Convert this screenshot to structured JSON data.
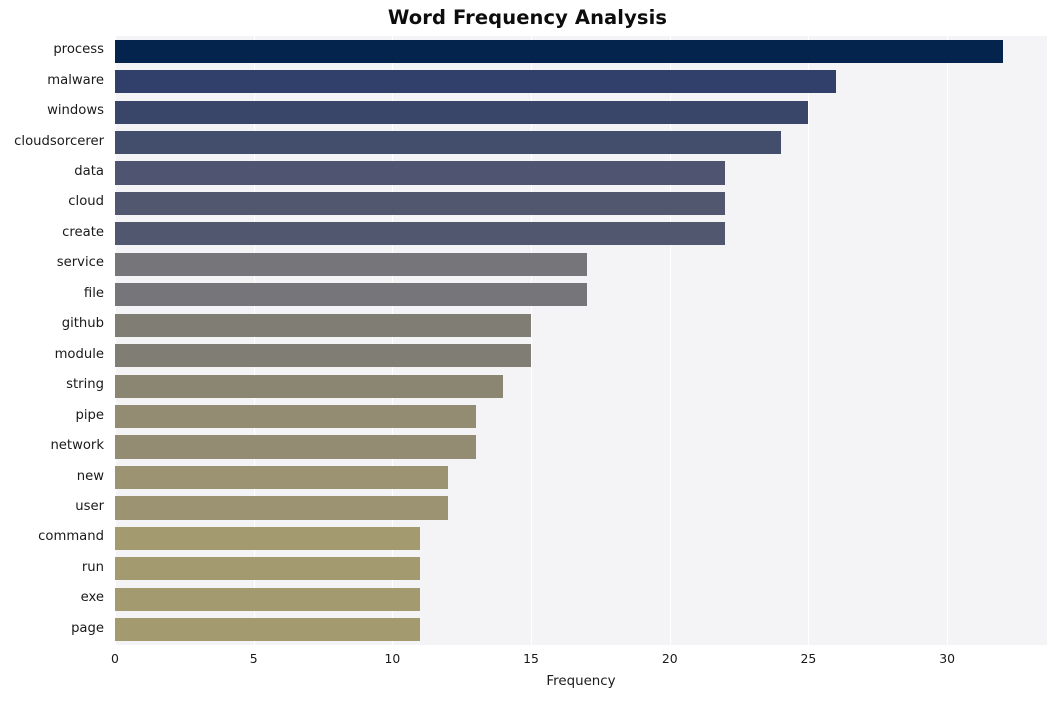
{
  "chart_data": {
    "type": "bar",
    "orientation": "horizontal",
    "title": "Word Frequency Analysis",
    "xlabel": "Frequency",
    "ylabel": "",
    "xlim": [
      0,
      33.6
    ],
    "xticks": [
      0,
      5,
      10,
      15,
      20,
      25,
      30
    ],
    "xtick_labels": [
      "0",
      "5",
      "10",
      "15",
      "20",
      "25",
      "30"
    ],
    "grid": "vertical-only",
    "legend": "none",
    "categories": [
      "process",
      "malware",
      "windows",
      "cloudsorcerer",
      "data",
      "cloud",
      "create",
      "service",
      "file",
      "github",
      "module",
      "string",
      "pipe",
      "network",
      "new",
      "user",
      "command",
      "run",
      "exe",
      "page"
    ],
    "values": [
      32,
      26,
      25,
      24,
      22,
      22,
      22,
      17,
      17,
      15,
      15,
      14,
      13,
      13,
      12,
      12,
      11,
      11,
      11,
      11
    ],
    "bar_colors": [
      "#04234d",
      "#31406b",
      "#3a4669",
      "#434d6c",
      "#4f5570",
      "#51576f",
      "#51576f",
      "#76767a",
      "#76767a",
      "#807e74",
      "#807e74",
      "#8a8671",
      "#938c73",
      "#938c73",
      "#9b9371",
      "#9b9371",
      "#a39a70",
      "#a39a70",
      "#a39a70",
      "#a39a70"
    ],
    "plot_background": "#f4f4f6",
    "figure_background": "#ffffff",
    "gridline_color": "#ffffff"
  }
}
